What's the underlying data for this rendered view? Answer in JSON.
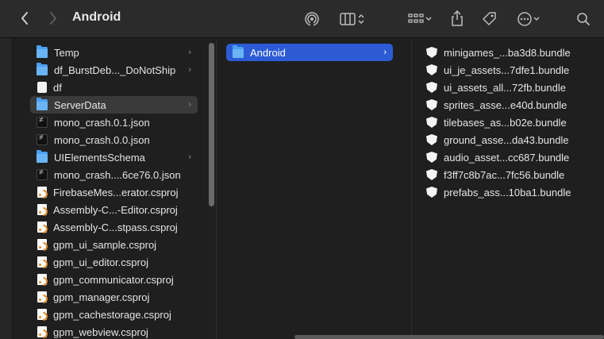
{
  "toolbar": {
    "title": "Android",
    "icons": [
      "back-chevron-icon",
      "forward-chevron-icon",
      "airdrop-icon",
      "column-view-icon",
      "group-by-icon",
      "share-icon",
      "tag-icon",
      "more-actions-icon",
      "search-icon"
    ]
  },
  "column1": {
    "items": [
      {
        "label": "Temp",
        "icon": "folder",
        "chevron": "›"
      },
      {
        "label": "df_BurstDeb..._DoNotShip",
        "icon": "folder",
        "chevron": "›"
      },
      {
        "label": "df",
        "icon": "document"
      },
      {
        "label": "ServerData",
        "icon": "folder",
        "chevron": "›",
        "selected": true
      },
      {
        "label": "mono_crash.0.1.json",
        "icon": "json"
      },
      {
        "label": "mono_crash.0.0.json",
        "icon": "json"
      },
      {
        "label": "UIElementsSchema",
        "icon": "folder",
        "chevron": "›"
      },
      {
        "label": "mono_crash....6ce76.0.json",
        "icon": "json"
      },
      {
        "label": "FirebaseMes...erator.csproj",
        "icon": "csproj"
      },
      {
        "label": "Assembly-C...-Editor.csproj",
        "icon": "csproj"
      },
      {
        "label": "Assembly-C...stpass.csproj",
        "icon": "csproj"
      },
      {
        "label": "gpm_ui_sample.csproj",
        "icon": "csproj"
      },
      {
        "label": "gpm_ui_editor.csproj",
        "icon": "csproj"
      },
      {
        "label": "gpm_communicator.csproj",
        "icon": "csproj"
      },
      {
        "label": "gpm_manager.csproj",
        "icon": "csproj"
      },
      {
        "label": "gpm_cachestorage.csproj",
        "icon": "csproj"
      },
      {
        "label": "gpm_webview.csproj",
        "icon": "csproj"
      }
    ]
  },
  "column2": {
    "items": [
      {
        "label": "Android",
        "icon": "folder",
        "chevron": "›",
        "selected": true
      }
    ]
  },
  "column3": {
    "items": [
      {
        "label": "minigames_...ba3d8.bundle",
        "icon": "bundle"
      },
      {
        "label": "ui_je_assets...7dfe1.bundle",
        "icon": "bundle"
      },
      {
        "label": "ui_assets_all...72fb.bundle",
        "icon": "bundle"
      },
      {
        "label": "sprites_asse...e40d.bundle",
        "icon": "bundle"
      },
      {
        "label": "tilebases_as...b02e.bundle",
        "icon": "bundle"
      },
      {
        "label": "ground_asse...da43.bundle",
        "icon": "bundle"
      },
      {
        "label": "audio_asset...cc687.bundle",
        "icon": "bundle"
      },
      {
        "label": "f3ff7c8b7ac...7fc56.bundle",
        "icon": "bundle"
      },
      {
        "label": "prefabs_ass...10ba1.bundle",
        "icon": "bundle"
      }
    ]
  },
  "colors": {
    "accent": "#2c5bd5",
    "folder": "#4aa0f0",
    "toolbar": "#2b2b2b",
    "background": "#1f1f1f"
  }
}
